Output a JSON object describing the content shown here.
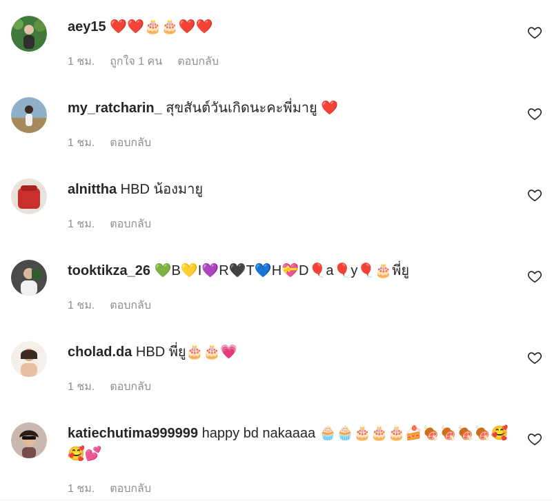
{
  "comments": [
    {
      "username": "aey15",
      "text": " ❤️❤️🎂🎂❤️❤️",
      "time": "1 ชม.",
      "likes": "ถูกใจ 1 คน",
      "reply": "ตอบกลับ",
      "avatar_color": "#3f7a3a"
    },
    {
      "username": "my_ratcharin_",
      "text": " สุขสันต์วันเกิดนะคะพี่มายู ❤️",
      "time": "1 ชม.",
      "reply": "ตอบกลับ",
      "avatar_color": "#8fb0c8"
    },
    {
      "username": "alnittha",
      "text": " HBD น้องมายู",
      "time": "1 ชม.",
      "reply": "ตอบกลับ",
      "avatar_color": "#c9302c"
    },
    {
      "username": "tooktikza_26",
      "text": " 💚B💛I💜R🖤T💙H💝D🎈a🎈y🎈🎂พี่ยู",
      "time": "1 ชม.",
      "reply": "ตอบกลับ",
      "avatar_color": "#4a4a4a"
    },
    {
      "username": "cholad.da",
      "text": " HBD พี่ยู🎂🎂💗",
      "time": "1 ชม.",
      "reply": "ตอบกลับ",
      "avatar_color": "#d9a77e"
    },
    {
      "username": "katiechutima999999",
      "text": " happy bd nakaaaa 🧁🧁🎂🎂🎂🍰🍖🍖🍖🍖🥰🥰💕",
      "time": "1 ชม.",
      "reply": "ตอบกลับ",
      "avatar_color": "#7a4b4b"
    }
  ],
  "icons": {
    "like": "heart-outline-icon"
  },
  "colors": {
    "meta_text": "#8e8e8e",
    "body_text": "#262626"
  }
}
